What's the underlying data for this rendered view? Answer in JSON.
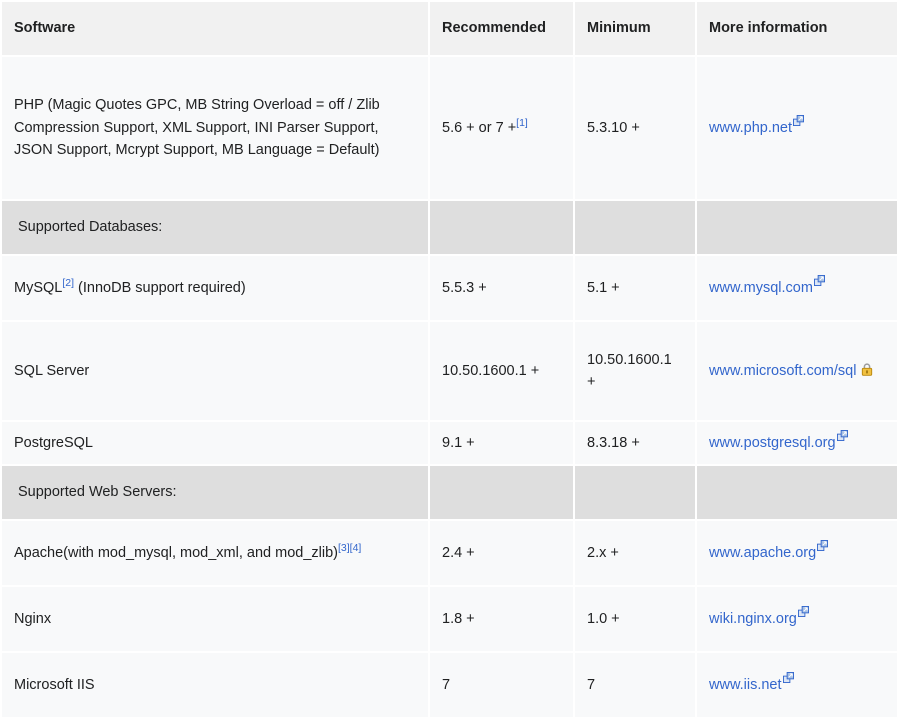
{
  "table": {
    "headers": {
      "software": "Software",
      "recommended": "Recommended",
      "minimum": "Minimum",
      "more_information": "More information"
    },
    "rows": [
      {
        "type": "data",
        "key": "php",
        "software": "PHP (Magic Quotes GPC, MB String Overload = off / Zlib Compression Support, XML Support, INI Parser Support, JSON Support, Mcrypt Support, MB Language = Default)",
        "recommended": "5.6 + or 7 +",
        "recommended_ref": "[1]",
        "minimum": "5.3.10 +",
        "link_text": "www.php.net",
        "link_icon": "external-link-icon"
      },
      {
        "type": "section",
        "key": "databases",
        "label": "Supported Databases:"
      },
      {
        "type": "data",
        "key": "mysql",
        "software_pre": "MySQL",
        "software_ref": "[2]",
        "software_post": " (InnoDB support required)",
        "recommended": "5.5.3 +",
        "minimum": "5.1 +",
        "link_text": "www.mysql.com",
        "link_icon": "external-link-icon"
      },
      {
        "type": "data",
        "key": "sqlserver",
        "software": "SQL Server",
        "recommended": "10.50.1600.1 +",
        "minimum": "10.50.1600.1 +",
        "link_text": "www.microsoft.com/sql",
        "link_icon": "lock-icon"
      },
      {
        "type": "data",
        "key": "postgresql",
        "software": "PostgreSQL",
        "recommended": "9.1 +",
        "minimum": "8.3.18 +",
        "link_text": "www.postgresql.org",
        "link_icon": "external-link-icon"
      },
      {
        "type": "section",
        "key": "webservers",
        "label": "Supported Web Servers:"
      },
      {
        "type": "data",
        "key": "apache",
        "software_pre": "Apache(with mod_mysql, mod_xml, and mod_zlib)",
        "software_ref": "[3][4]",
        "recommended": "2.4 +",
        "minimum": "2.x +",
        "link_text": "www.apache.org",
        "link_icon": "external-link-icon"
      },
      {
        "type": "data",
        "key": "nginx",
        "software": "Nginx",
        "recommended": "1.8 +",
        "minimum": "1.0 +",
        "link_text": "wiki.nginx.org",
        "link_icon": "external-link-icon"
      },
      {
        "type": "data",
        "key": "iis",
        "software": "Microsoft IIS",
        "recommended": "7",
        "minimum": "7",
        "link_text": "www.iis.net",
        "link_icon": "external-link-icon"
      }
    ]
  },
  "colors": {
    "header_bg": "#f1f1f1",
    "section_bg": "#dedede",
    "cell_bg": "#f8f9fa",
    "link": "#3366cc",
    "text": "#202122",
    "lock_gold": "#f0c040"
  }
}
